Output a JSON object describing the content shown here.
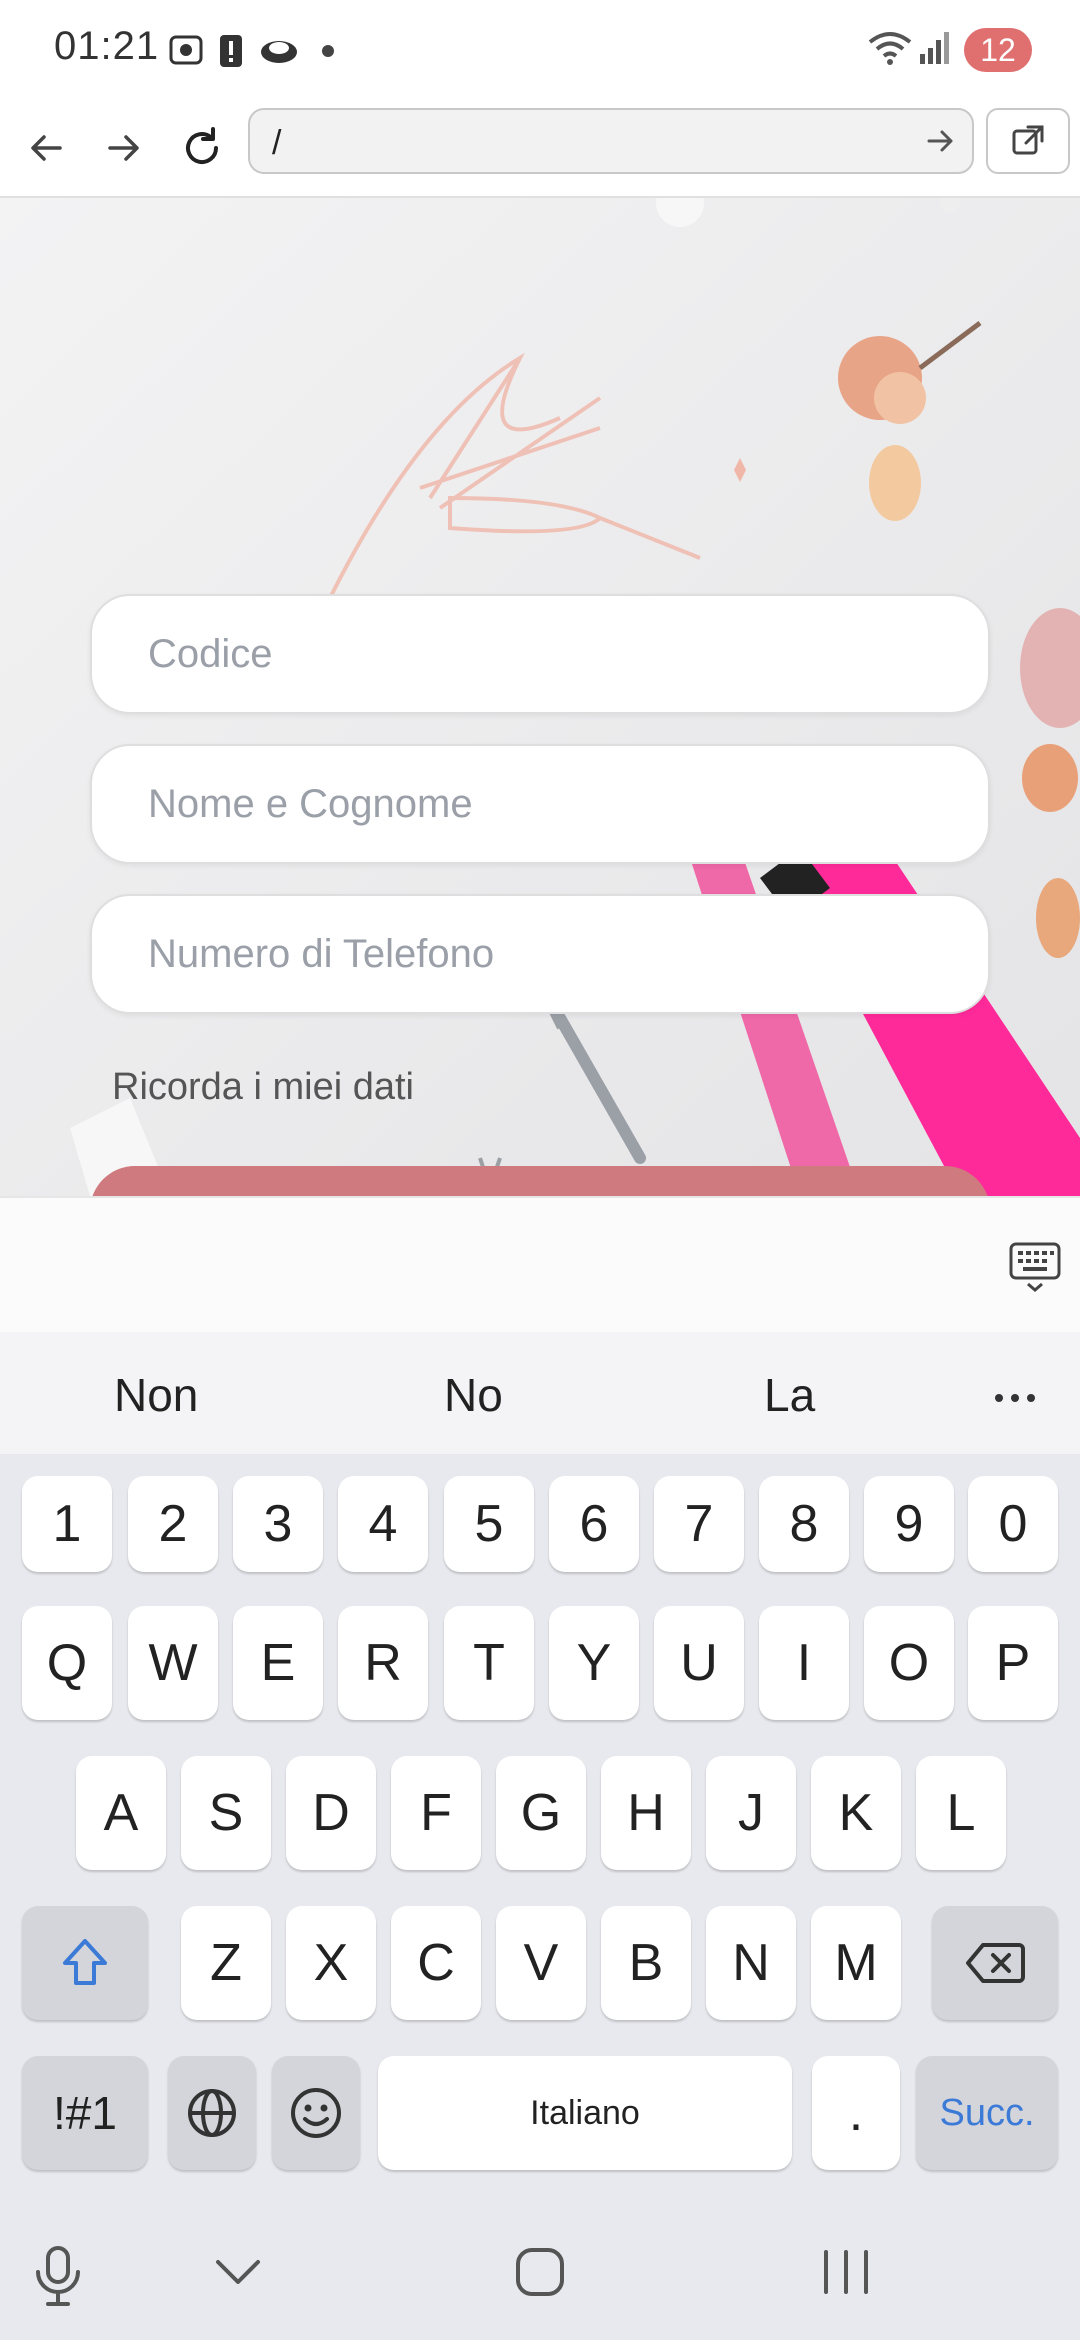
{
  "status_bar": {
    "time": "01:21",
    "notification_count": "12",
    "badge_color": "#e07070"
  },
  "browser": {
    "url": "/"
  },
  "form": {
    "code_placeholder": "Codice",
    "name_placeholder": "Nome e Cognome",
    "phone_placeholder": "Numero di Telefono",
    "remember_label": "Ricorda i miei dati",
    "submit_color": "#cf7a7e"
  },
  "keyboard": {
    "suggestions": [
      "Non",
      "No",
      "La"
    ],
    "numbers": [
      "1",
      "2",
      "3",
      "4",
      "5",
      "6",
      "7",
      "8",
      "9",
      "0"
    ],
    "row1": [
      "Q",
      "W",
      "E",
      "R",
      "T",
      "Y",
      "U",
      "I",
      "O",
      "P"
    ],
    "row2": [
      "A",
      "S",
      "D",
      "F",
      "G",
      "H",
      "J",
      "K",
      "L"
    ],
    "row3": [
      "Z",
      "X",
      "C",
      "V",
      "B",
      "N",
      "M"
    ],
    "symbols_label": "!#1",
    "space_label": "Italiano",
    "period_label": ".",
    "enter_label": "Succ.",
    "enter_color": "#3b7ad6"
  }
}
